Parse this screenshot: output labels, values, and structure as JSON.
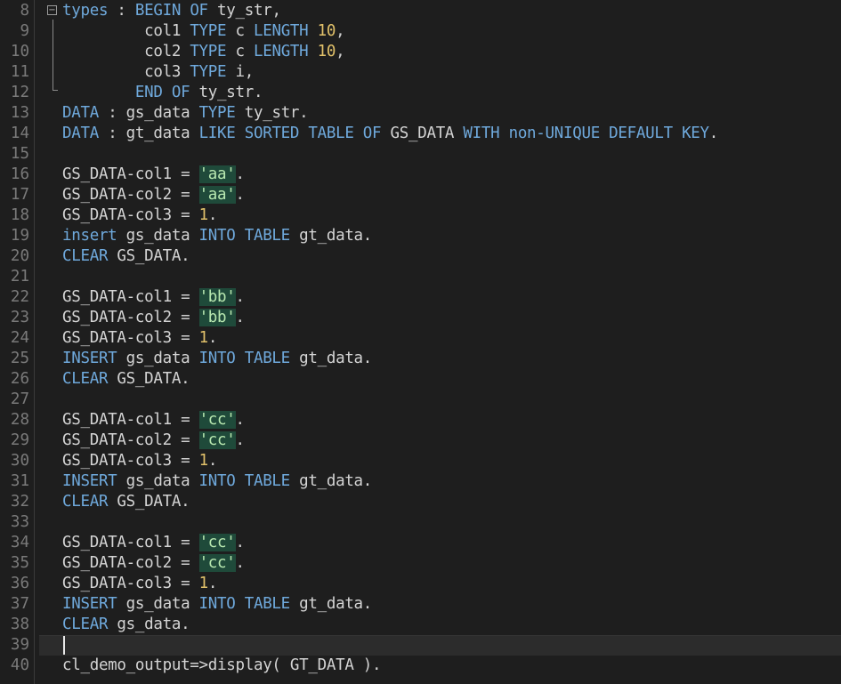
{
  "editor": {
    "language": "ABAP",
    "current_line": 39,
    "lines": [
      {
        "num": "8",
        "tokens": [
          [
            "kw",
            "types"
          ],
          [
            "op",
            " : "
          ],
          [
            "kw",
            "BEGIN OF"
          ],
          [
            "id",
            " ty_str,"
          ]
        ]
      },
      {
        "num": "9",
        "tokens": [
          [
            "id",
            "         col1 "
          ],
          [
            "kw",
            "TYPE"
          ],
          [
            "id",
            " c "
          ],
          [
            "kw",
            "LENGTH"
          ],
          [
            "op",
            " "
          ],
          [
            "num",
            "10"
          ],
          [
            "op",
            ","
          ]
        ]
      },
      {
        "num": "10",
        "tokens": [
          [
            "id",
            "         col2 "
          ],
          [
            "kw",
            "TYPE"
          ],
          [
            "id",
            " c "
          ],
          [
            "kw",
            "LENGTH"
          ],
          [
            "op",
            " "
          ],
          [
            "num",
            "10"
          ],
          [
            "op",
            ","
          ]
        ]
      },
      {
        "num": "11",
        "tokens": [
          [
            "id",
            "         col3 "
          ],
          [
            "kw",
            "TYPE"
          ],
          [
            "id",
            " i,"
          ]
        ]
      },
      {
        "num": "12",
        "tokens": [
          [
            "op",
            "        "
          ],
          [
            "kw",
            "END OF"
          ],
          [
            "id",
            " ty_str."
          ]
        ]
      },
      {
        "num": "13",
        "tokens": [
          [
            "kw",
            "DATA"
          ],
          [
            "op",
            " : "
          ],
          [
            "id",
            "gs_data "
          ],
          [
            "kw",
            "TYPE"
          ],
          [
            "id",
            " ty_str."
          ]
        ]
      },
      {
        "num": "14",
        "tokens": [
          [
            "kw",
            "DATA"
          ],
          [
            "op",
            " : "
          ],
          [
            "id",
            "gt_data "
          ],
          [
            "kw",
            "LIKE SORTED TABLE OF"
          ],
          [
            "id",
            " GS_DATA "
          ],
          [
            "kw",
            "WITH non-UNIQUE DEFAULT KEY"
          ],
          [
            "op",
            "."
          ]
        ]
      },
      {
        "num": "15",
        "tokens": []
      },
      {
        "num": "16",
        "tokens": [
          [
            "id",
            "GS_DATA-col1 "
          ],
          [
            "op",
            "= "
          ],
          [
            "str",
            "'aa'"
          ],
          [
            "op",
            "."
          ]
        ]
      },
      {
        "num": "17",
        "tokens": [
          [
            "id",
            "GS_DATA-col2 "
          ],
          [
            "op",
            "= "
          ],
          [
            "str",
            "'aa'"
          ],
          [
            "op",
            "."
          ]
        ]
      },
      {
        "num": "18",
        "tokens": [
          [
            "id",
            "GS_DATA-col3 "
          ],
          [
            "op",
            "= "
          ],
          [
            "num",
            "1"
          ],
          [
            "op",
            "."
          ]
        ]
      },
      {
        "num": "19",
        "tokens": [
          [
            "kw",
            "insert"
          ],
          [
            "id",
            " gs_data "
          ],
          [
            "kw",
            "INTO TABLE"
          ],
          [
            "id",
            " gt_data."
          ]
        ]
      },
      {
        "num": "20",
        "tokens": [
          [
            "kw",
            "CLEAR"
          ],
          [
            "id",
            " GS_DATA."
          ]
        ]
      },
      {
        "num": "21",
        "tokens": []
      },
      {
        "num": "22",
        "tokens": [
          [
            "id",
            "GS_DATA-col1 "
          ],
          [
            "op",
            "= "
          ],
          [
            "str",
            "'bb'"
          ],
          [
            "op",
            "."
          ]
        ]
      },
      {
        "num": "23",
        "tokens": [
          [
            "id",
            "GS_DATA-col2 "
          ],
          [
            "op",
            "= "
          ],
          [
            "str",
            "'bb'"
          ],
          [
            "op",
            "."
          ]
        ]
      },
      {
        "num": "24",
        "tokens": [
          [
            "id",
            "GS_DATA-col3 "
          ],
          [
            "op",
            "= "
          ],
          [
            "num",
            "1"
          ],
          [
            "op",
            "."
          ]
        ]
      },
      {
        "num": "25",
        "tokens": [
          [
            "kw",
            "INSERT"
          ],
          [
            "id",
            " gs_data "
          ],
          [
            "kw",
            "INTO TABLE"
          ],
          [
            "id",
            " gt_data."
          ]
        ]
      },
      {
        "num": "26",
        "tokens": [
          [
            "kw",
            "CLEAR"
          ],
          [
            "id",
            " GS_DATA."
          ]
        ]
      },
      {
        "num": "27",
        "tokens": []
      },
      {
        "num": "28",
        "tokens": [
          [
            "id",
            "GS_DATA-col1 "
          ],
          [
            "op",
            "= "
          ],
          [
            "str",
            "'cc'"
          ],
          [
            "op",
            "."
          ]
        ]
      },
      {
        "num": "29",
        "tokens": [
          [
            "id",
            "GS_DATA-col2 "
          ],
          [
            "op",
            "= "
          ],
          [
            "str",
            "'cc'"
          ],
          [
            "op",
            "."
          ]
        ]
      },
      {
        "num": "30",
        "tokens": [
          [
            "id",
            "GS_DATA-col3 "
          ],
          [
            "op",
            "= "
          ],
          [
            "num",
            "1"
          ],
          [
            "op",
            "."
          ]
        ]
      },
      {
        "num": "31",
        "tokens": [
          [
            "kw",
            "INSERT"
          ],
          [
            "id",
            " gs_data "
          ],
          [
            "kw",
            "INTO TABLE"
          ],
          [
            "id",
            " gt_data."
          ]
        ]
      },
      {
        "num": "32",
        "tokens": [
          [
            "kw",
            "CLEAR"
          ],
          [
            "id",
            " GS_DATA."
          ]
        ]
      },
      {
        "num": "33",
        "tokens": []
      },
      {
        "num": "34",
        "tokens": [
          [
            "id",
            "GS_DATA-col1 "
          ],
          [
            "op",
            "= "
          ],
          [
            "str",
            "'cc'"
          ],
          [
            "op",
            "."
          ]
        ]
      },
      {
        "num": "35",
        "tokens": [
          [
            "id",
            "GS_DATA-col2 "
          ],
          [
            "op",
            "= "
          ],
          [
            "str",
            "'cc'"
          ],
          [
            "op",
            "."
          ]
        ]
      },
      {
        "num": "36",
        "tokens": [
          [
            "id",
            "GS_DATA-col3 "
          ],
          [
            "op",
            "= "
          ],
          [
            "num",
            "1"
          ],
          [
            "op",
            "."
          ]
        ]
      },
      {
        "num": "37",
        "tokens": [
          [
            "kw",
            "INSERT"
          ],
          [
            "id",
            " gs_data "
          ],
          [
            "kw",
            "INTO TABLE"
          ],
          [
            "id",
            " gt_data."
          ]
        ]
      },
      {
        "num": "38",
        "tokens": [
          [
            "kw",
            "CLEAR"
          ],
          [
            "id",
            " gs_data."
          ]
        ]
      },
      {
        "num": "39",
        "tokens": []
      },
      {
        "num": "40",
        "tokens": [
          [
            "id",
            "cl_demo_output=>display( GT_DATA )."
          ]
        ]
      }
    ]
  },
  "fold_toggle": {
    "icon": "collapse-minus-icon",
    "glyph": "−"
  },
  "colors": {
    "background": "#1e1e1e",
    "keyword": "#6fa9dc",
    "identifier": "#d4d4d4",
    "number": "#e1c16a",
    "string": "#b8e8b0",
    "string_bg": "#1f4a3a",
    "line_number": "#7a7a7a"
  }
}
